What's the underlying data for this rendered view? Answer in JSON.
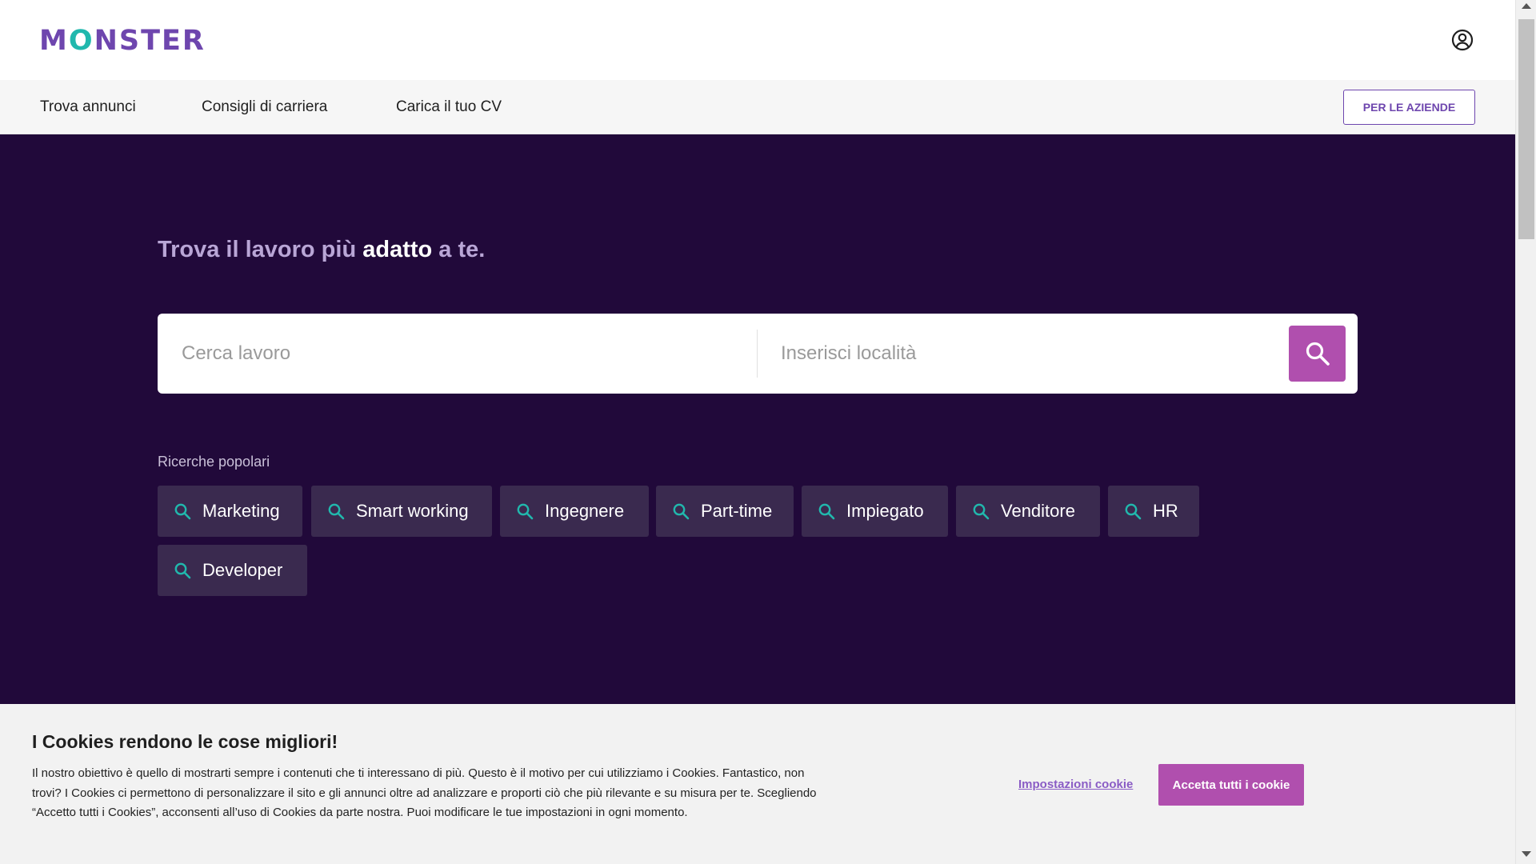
{
  "header": {
    "logo": {
      "before": "M",
      "o": "O",
      "after": "NSTER"
    },
    "account_icon": "user-circle-icon"
  },
  "nav": {
    "items": [
      {
        "label": "Trova annunci"
      },
      {
        "label": "Consigli di carriera"
      },
      {
        "label": "Carica il tuo CV"
      }
    ],
    "employers_label": "PER LE AZIENDE"
  },
  "hero": {
    "title_part1": "Trova il lavoro più ",
    "title_highlight": "adatto",
    "title_part2": " a te.",
    "search": {
      "job_placeholder": "Cerca lavoro",
      "location_placeholder": "Inserisci località",
      "button_icon": "search-icon"
    },
    "popular_label": "Ricerche popolari",
    "popular_searches": [
      "Marketing",
      "Smart working",
      "Ingegnere",
      "Part-time",
      "Impiegato",
      "Venditore",
      "HR",
      "Developer"
    ]
  },
  "cookie": {
    "title": "I Cookies rendono le cose migliori!",
    "text": "Il nostro obiettivo è quello di mostrarti sempre i contenuti che ti interessano di più. Questo è il motivo per cui utilizziamo i Cookies. Fantastico, non trovi? I Cookies ci permettono di personalizzare il sito e gli annunci oltre ad analizzare e proporti ciò che più rilevante e su misura per te. Scegliendo “Accetto tutti i Cookies”, acconsenti all’uso di Cookies da parte nostra. Puoi modificare le tue impostazioni in ogni momento.",
    "settings_label": "Impostazioni cookie",
    "accept_label": "Accetta tutti i cookie"
  },
  "colors": {
    "brand_purple": "#6e46ae",
    "brand_teal": "#21b8ad",
    "hero_bg": "#21093a",
    "accent_magenta": "#b04fae",
    "chip_bg": "#3a2a4f"
  }
}
